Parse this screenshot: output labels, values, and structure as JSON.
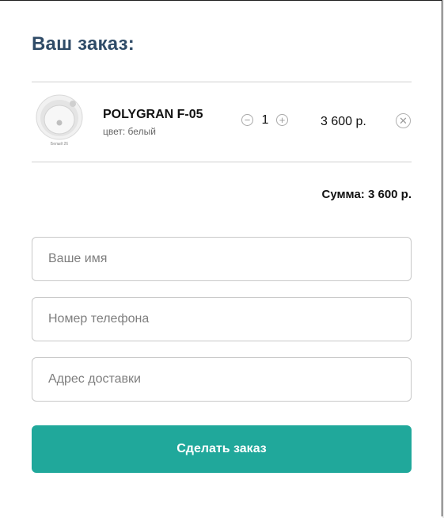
{
  "order": {
    "title": "Ваш заказ:",
    "items": [
      {
        "name": "POLYGRAN F-05",
        "color_label": "цвет: белый",
        "quantity": "1",
        "price": "3 600 р.",
        "thumb_caption": "Белый 26"
      }
    ],
    "total": "Сумма: 3 600 р."
  },
  "form": {
    "name_placeholder": "Ваше имя",
    "phone_placeholder": "Номер телефона",
    "address_placeholder": "Адрес доставки",
    "submit_label": "Сделать заказ"
  },
  "colors": {
    "title": "#2f4b67",
    "accent": "#20a89b"
  },
  "icons": {
    "qty_decrease": "minus-circle-icon",
    "qty_increase": "plus-circle-icon",
    "remove_item": "close-circle-icon"
  }
}
